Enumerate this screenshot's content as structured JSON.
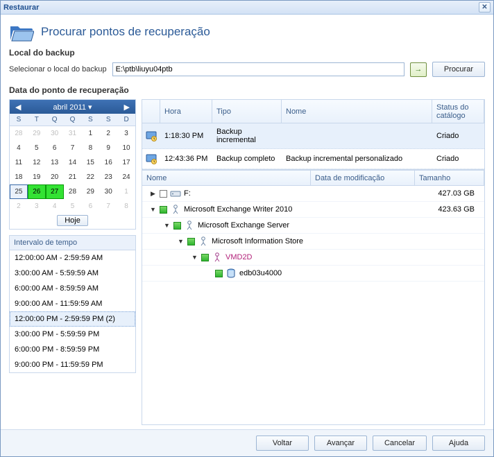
{
  "window_title": "Restaurar",
  "header": {
    "title": "Procurar pontos de recuperação"
  },
  "location": {
    "section_label": "Local do backup",
    "field_label": "Selecionar o local do backup",
    "value": "E:\\ptb\\liuyu04ptb",
    "browse_label": "Procurar"
  },
  "date_section_label": "Data do ponto de recuperação",
  "calendar": {
    "month_label": "abril 2011",
    "today_label": "Hoje",
    "dow": [
      "S",
      "T",
      "Q",
      "Q",
      "S",
      "S",
      "D"
    ],
    "weeks": [
      [
        {
          "d": 28,
          "other": true
        },
        {
          "d": 29,
          "other": true
        },
        {
          "d": 30,
          "other": true
        },
        {
          "d": 31,
          "other": true
        },
        {
          "d": 1
        },
        {
          "d": 2
        },
        {
          "d": 3
        }
      ],
      [
        {
          "d": 4
        },
        {
          "d": 5
        },
        {
          "d": 6
        },
        {
          "d": 7
        },
        {
          "d": 8
        },
        {
          "d": 9
        },
        {
          "d": 10
        }
      ],
      [
        {
          "d": 11
        },
        {
          "d": 12
        },
        {
          "d": 13
        },
        {
          "d": 14
        },
        {
          "d": 15
        },
        {
          "d": 16
        },
        {
          "d": 17
        }
      ],
      [
        {
          "d": 18
        },
        {
          "d": 19
        },
        {
          "d": 20
        },
        {
          "d": 21
        },
        {
          "d": 22
        },
        {
          "d": 23
        },
        {
          "d": 24
        }
      ],
      [
        {
          "d": 25,
          "sel": true
        },
        {
          "d": 26,
          "green": true
        },
        {
          "d": 27,
          "green": true
        },
        {
          "d": 28
        },
        {
          "d": 29
        },
        {
          "d": 30
        },
        {
          "d": 1,
          "other": true
        }
      ],
      [
        {
          "d": 2,
          "other": true
        },
        {
          "d": 3,
          "other": true
        },
        {
          "d": 4,
          "other": true
        },
        {
          "d": 5,
          "other": true
        },
        {
          "d": 6,
          "other": true
        },
        {
          "d": 7,
          "other": true
        },
        {
          "d": 8,
          "other": true
        }
      ]
    ]
  },
  "time_ranges": {
    "header": "Intervalo de tempo",
    "items": [
      {
        "label": "12:00:00 AM - 2:59:59 AM"
      },
      {
        "label": "3:00:00 AM - 5:59:59 AM"
      },
      {
        "label": "6:00:00 AM - 8:59:59 AM"
      },
      {
        "label": "9:00:00 AM - 11:59:59 AM"
      },
      {
        "label": "12:00:00 PM - 2:59:59 PM (2)",
        "selected": true
      },
      {
        "label": "3:00:00 PM - 5:59:59 PM"
      },
      {
        "label": "6:00:00 PM - 8:59:59 PM"
      },
      {
        "label": "9:00:00 PM - 11:59:59 PM"
      }
    ]
  },
  "backup_grid": {
    "columns": {
      "hora": "Hora",
      "tipo": "Tipo",
      "nome": "Nome",
      "status": "Status do catálogo"
    },
    "rows": [
      {
        "hora": "1:18:30 PM",
        "tipo": "Backup incremental",
        "nome": "",
        "status": "Criado",
        "selected": true
      },
      {
        "hora": "12:43:36 PM",
        "tipo": "Backup completo",
        "nome": "Backup incremental personalizado",
        "status": "Criado"
      }
    ]
  },
  "file_grid": {
    "columns": {
      "nome": "Nome",
      "data": "Data de modificação",
      "tamanho": "Tamanho"
    },
    "tree": [
      {
        "indent": 0,
        "exp": "▸",
        "check": "blank",
        "kind": "drive",
        "label": "F:",
        "size": "427.03 GB"
      },
      {
        "indent": 0,
        "exp": "▾",
        "check": "green",
        "kind": "writer",
        "label": "Microsoft Exchange Writer 2010",
        "size": "423.63 GB"
      },
      {
        "indent": 1,
        "exp": "▾",
        "check": "green",
        "kind": "server",
        "label": "Microsoft Exchange Server",
        "size": ""
      },
      {
        "indent": 2,
        "exp": "▾",
        "check": "green",
        "kind": "store",
        "label": "Microsoft Information Store",
        "size": ""
      },
      {
        "indent": 3,
        "exp": "▾",
        "check": "green",
        "kind": "vm",
        "label": "VMD2D",
        "size": ""
      },
      {
        "indent": 4,
        "exp": "",
        "check": "green",
        "kind": "db",
        "label": "edb03u4000",
        "size": ""
      }
    ]
  },
  "footer": {
    "back": "Voltar",
    "next": "Avançar",
    "cancel": "Cancelar",
    "help": "Ajuda"
  }
}
